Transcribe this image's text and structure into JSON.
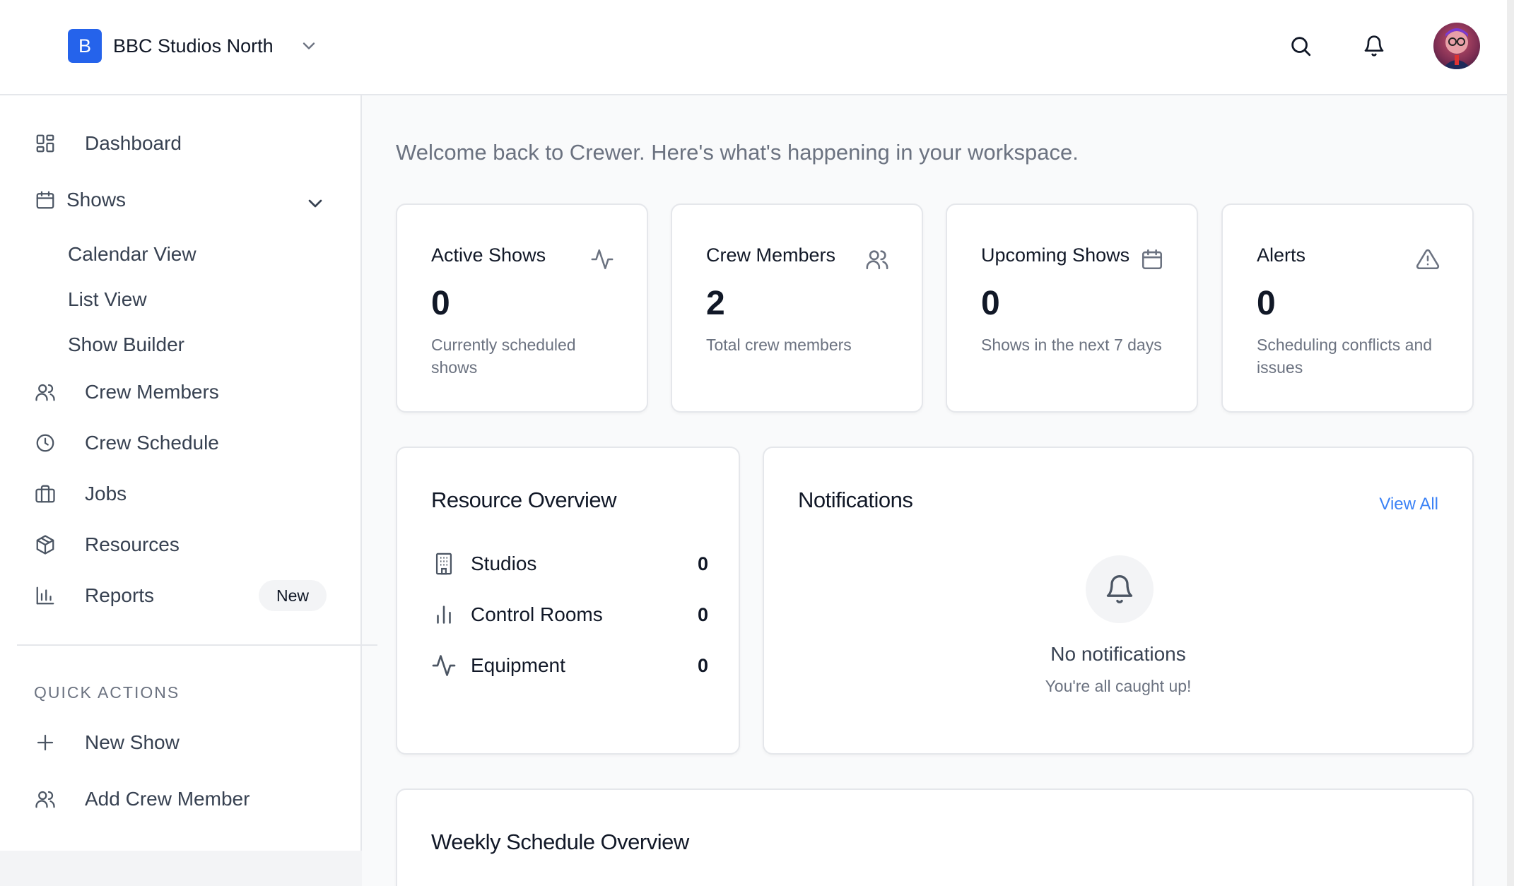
{
  "workspace": {
    "logo_letter": "B",
    "name": "BBC Studios North"
  },
  "header": {
    "icons": [
      "search-icon",
      "bell-icon",
      "avatar"
    ]
  },
  "sidebar": {
    "nav": [
      {
        "label": "Dashboard",
        "icon": "dashboard-grid-icon"
      },
      {
        "label": "Shows",
        "icon": "calendar-icon",
        "expanded": true
      },
      {
        "label": "Crew Members",
        "icon": "users-icon"
      },
      {
        "label": "Crew Schedule",
        "icon": "clock-icon"
      },
      {
        "label": "Jobs",
        "icon": "briefcase-icon"
      },
      {
        "label": "Resources",
        "icon": "package-icon"
      },
      {
        "label": "Reports",
        "icon": "bar-chart-icon",
        "badge": "New"
      }
    ],
    "shows_sub": [
      "Calendar View",
      "List View",
      "Show Builder"
    ],
    "quick_actions_heading": "QUICK ACTIONS",
    "quick_actions": [
      {
        "label": "New Show",
        "icon": "plus-icon"
      },
      {
        "label": "Add Crew Member",
        "icon": "users-icon"
      }
    ]
  },
  "main": {
    "welcome": "Welcome back to Crewer. Here's what's happening in your workspace.",
    "stats": [
      {
        "title": "Active Shows",
        "value": "0",
        "desc": "Currently scheduled shows",
        "icon": "activity-icon"
      },
      {
        "title": "Crew Members",
        "value": "2",
        "desc": "Total crew members",
        "icon": "users-icon"
      },
      {
        "title": "Upcoming Shows",
        "value": "0",
        "desc": "Shows in the next 7 days",
        "icon": "calendar-icon"
      },
      {
        "title": "Alerts",
        "value": "0",
        "desc": "Scheduling conflicts and issues",
        "icon": "alert-triangle-icon"
      }
    ],
    "resources": {
      "title": "Resource Overview",
      "rows": [
        {
          "label": "Studios",
          "value": "0",
          "icon": "building-icon"
        },
        {
          "label": "Control Rooms",
          "value": "0",
          "icon": "bar-chart-icon"
        },
        {
          "label": "Equipment",
          "value": "0",
          "icon": "activity-icon"
        }
      ]
    },
    "notifications": {
      "title": "Notifications",
      "view_all": "View All",
      "empty_title": "No notifications",
      "empty_sub": "You're all caught up!"
    },
    "weekly": {
      "title": "Weekly Schedule Overview"
    }
  },
  "colors": {
    "accent": "#2563eb",
    "link": "#3b82f6",
    "text": "#111827",
    "muted": "#6b7280",
    "border": "#e5e7eb"
  }
}
